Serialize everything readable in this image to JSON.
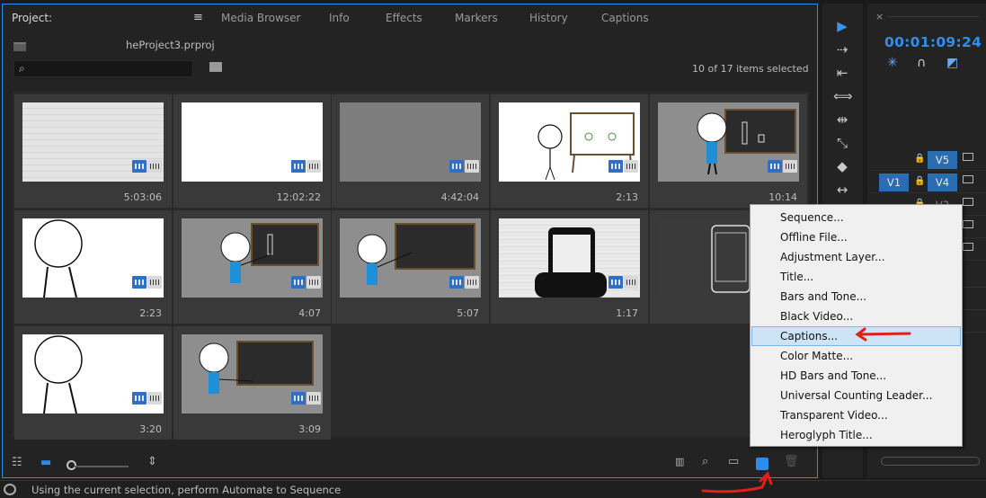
{
  "project_panel": {
    "tabs": [
      {
        "label": "Project:",
        "active": true
      },
      {
        "label": "Media Browser"
      },
      {
        "label": "Info"
      },
      {
        "label": "Effects"
      },
      {
        "label": "Markers"
      },
      {
        "label": "History"
      },
      {
        "label": "Captions"
      }
    ],
    "project_filename": "heProject3.prproj",
    "search": {
      "value": "",
      "placeholder": ""
    },
    "selection_count": "10 of 17 items selected",
    "clips": [
      {
        "duration": "5:03:06",
        "thumb": "lined-paper"
      },
      {
        "duration": "12:02:22",
        "thumb": "white"
      },
      {
        "duration": "4:42:04",
        "thumb": "grey"
      },
      {
        "duration": "2:13",
        "thumb": "figure-whiteboard"
      },
      {
        "duration": "10:14",
        "thumb": "figure-blackboard-chart"
      },
      {
        "duration": "2:23",
        "thumb": "figure-closeup"
      },
      {
        "duration": "4:07",
        "thumb": "figure-blackboard-chart"
      },
      {
        "duration": "5:07",
        "thumb": "figure-blackboard"
      },
      {
        "duration": "1:17",
        "thumb": "hand-phone"
      },
      {
        "duration": "",
        "thumb": "phone-outline"
      },
      {
        "duration": "3:20",
        "thumb": "figure-closeup"
      },
      {
        "duration": "3:09",
        "thumb": "figure-blackboard"
      }
    ],
    "footer_icons": [
      "list-view-icon",
      "icon-view-icon",
      "zoom-slider",
      "sort-icon",
      "automate-icon",
      "find-icon",
      "new-bin-icon",
      "new-item-icon",
      "trash-icon"
    ]
  },
  "new_item_menu": {
    "items": [
      {
        "label": "Sequence..."
      },
      {
        "label": "Offline File..."
      },
      {
        "label": "Adjustment Layer..."
      },
      {
        "label": "Title..."
      },
      {
        "label": "Bars and Tone..."
      },
      {
        "label": "Black Video..."
      },
      {
        "label": "Captions...",
        "highlighted": true
      },
      {
        "label": "Color Matte..."
      },
      {
        "label": "HD Bars and Tone..."
      },
      {
        "label": "Universal Counting Leader..."
      },
      {
        "label": "Transparent Video..."
      },
      {
        "label": "Heroglyph Title..."
      }
    ]
  },
  "timeline": {
    "timecode": "00:01:09:24",
    "tracks": [
      {
        "label": "V5",
        "source": ""
      },
      {
        "label": "V4",
        "source": "V1"
      },
      {
        "label": "V3",
        "source": ""
      }
    ]
  },
  "status_bar": {
    "text": "Using the current selection, perform Automate to Sequence"
  },
  "colors": {
    "accent": "#2d8ceb",
    "annotation": "#e0201b",
    "timecode": "#2f8fee"
  }
}
